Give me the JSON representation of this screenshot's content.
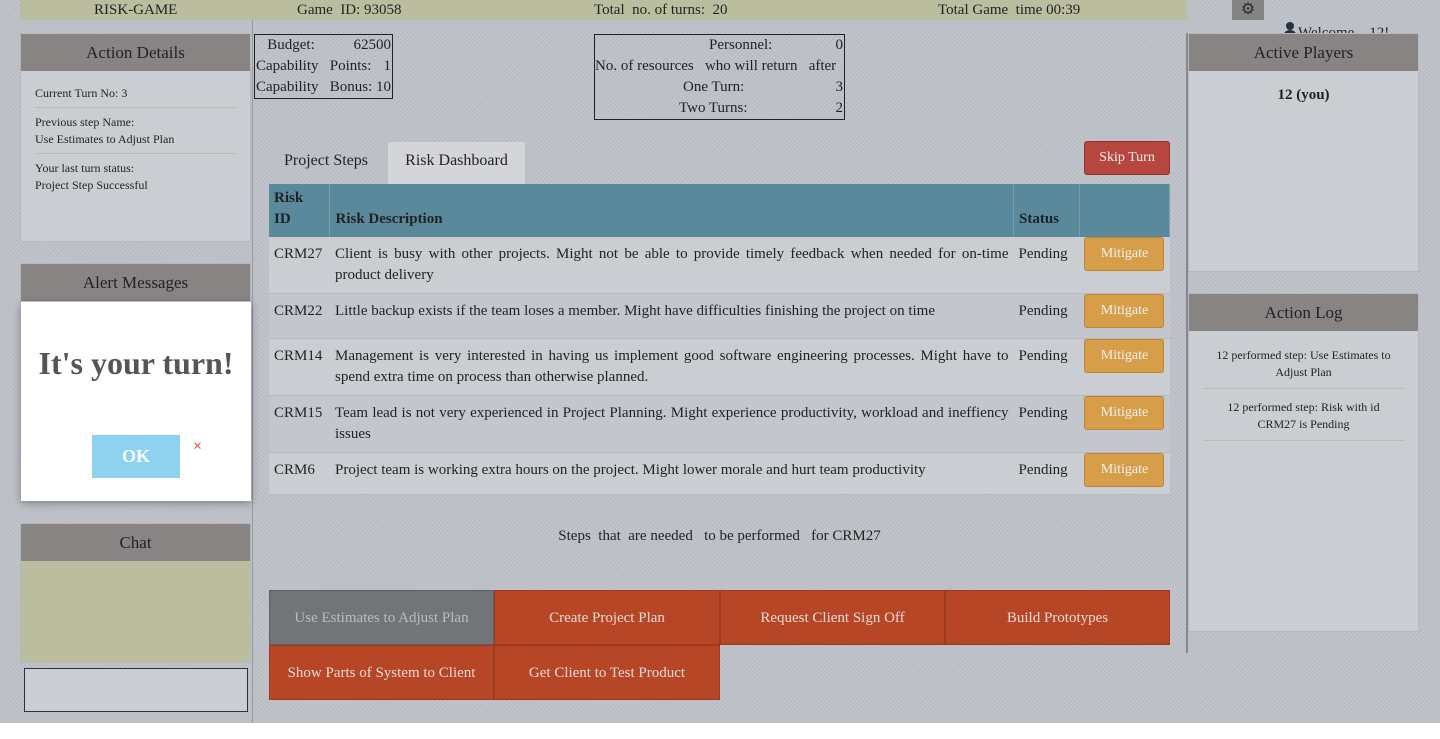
{
  "header": {
    "app_name": "RISK-GAME",
    "game_id": "Game  ID: 93058",
    "total_turns": "Total  no. of turns:  20",
    "total_time": "Total Game  time 00:39",
    "welcome": "Welcome    12!"
  },
  "action_details": {
    "title": "Action  Details",
    "current_turn": "Current   Turn  No: 3",
    "previous_step_label": "Previous   step  Name:",
    "previous_step_value": "Use Estimates  to Adjust  Plan",
    "last_status_label": "Your last  turn  status:",
    "last_status_value": "Project Step Successful"
  },
  "alert_messages": {
    "title": "Alert  Messages"
  },
  "chat": {
    "title": "Chat"
  },
  "modal": {
    "title": "It's your turn!",
    "ok_label": "OK",
    "close_glyph": "×"
  },
  "budget": {
    "rows": [
      {
        "label": "   Budget:",
        "value": "62500"
      },
      {
        "label": "Capability   Points:",
        "value": "1"
      },
      {
        "label": "Capability   Bonus:",
        "value": "10"
      }
    ]
  },
  "personnel": {
    "personnel_label": "Personnel:",
    "personnel_value": "0",
    "return_label": "No. of resources   who will return   after",
    "one_turn_label": "One Turn:",
    "one_turn_value": "3",
    "two_turns_label": "Two Turns:",
    "two_turns_value": "2"
  },
  "tabs": {
    "project_steps": "Project  Steps",
    "risk_dashboard": "Risk  Dashboard"
  },
  "skip_turn": "Skip  Turn",
  "risk_table": {
    "headers": {
      "id_line1": "Risk",
      "id_line2": "ID",
      "description": "Risk  Description",
      "status": "Status"
    },
    "rows": [
      {
        "id": "CRM27",
        "description": "Client is busy with other projects. Might not be able to provide  timely feedback  when needed  for on-time product  delivery",
        "status": "Pending",
        "action": "Mitigate"
      },
      {
        "id": "CRM22",
        "description": "Little backup  exists if the team loses a member.  Might have difficulties  finishing  the project on time",
        "status": "Pending",
        "action": "Mitigate"
      },
      {
        "id": "CRM14",
        "description": "Management  is very interested  in having  us implement  good software  engineering  processes.  Might have  to spend  extra time on process  than  otherwise  planned.",
        "status": "Pending",
        "action": "Mitigate"
      },
      {
        "id": "CRM15",
        "description": "Team lead is not very experienced  in Project Planning.  Might experience  productivity,  workload  and ineffiency  issues",
        "status": "Pending",
        "action": "Mitigate"
      },
      {
        "id": "CRM6",
        "description": "Project team  is working  extra hours  on the project. Might lower morale  and hurt  team productivity",
        "status": "Pending",
        "action": "Mitigate"
      }
    ]
  },
  "steps_caption": "Steps  that  are needed   to be performed   for CRM27",
  "steps": [
    "Use Estimates  to Adjust  Plan",
    "Create  Project  Plan",
    "Request  Client  Sign  Off",
    "Build  Prototypes",
    "Show  Parts  of System  to Client",
    "Get Client  to Test Product"
  ],
  "active_players": {
    "title": "Active  Players",
    "entry": "12 (you)"
  },
  "action_log": {
    "title": "Action  Log",
    "items": [
      "12 performed   step:  Use Estimates  to Adjust  Plan",
      "12 performed   step:  Risk with  id CRM27 is Pending"
    ]
  },
  "icons": {
    "settings": "gear-icon",
    "user": "user-icon",
    "close": "close-icon"
  },
  "colors": {
    "header_bar": "#c6c8a8",
    "panel_head": "#8f8a8a",
    "table_head": "#5c90a3",
    "mitigate": "#e3a64a",
    "skip": "#c1473e",
    "step": "#c24724",
    "step_done": "#777a7d",
    "ok_button": "#8fd2ef"
  }
}
